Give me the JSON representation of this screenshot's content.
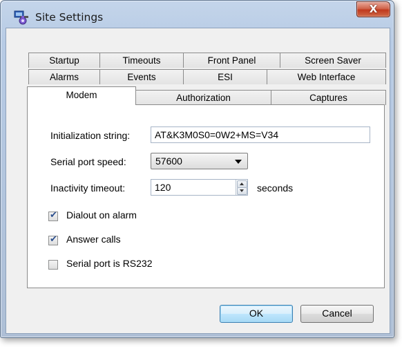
{
  "window": {
    "title": "Site Settings",
    "close_label": "X",
    "icon": "site-settings-app-icon"
  },
  "tabs": {
    "row1": [
      "Startup",
      "Timeouts",
      "Front Panel",
      "Screen Saver"
    ],
    "row2": [
      "Alarms",
      "Events",
      "ESI",
      "Web Interface"
    ],
    "row3": [
      "Modem",
      "Authorization",
      "Captures"
    ],
    "active": "Modem"
  },
  "modem": {
    "init_label": "Initialization string:",
    "init_value": "AT&K3M0S0=0W2+MS=V34",
    "speed_label": "Serial port speed:",
    "speed_value": "57600",
    "timeout_label": "Inactivity timeout:",
    "timeout_value": "120",
    "timeout_unit": "seconds",
    "dialout_label": "Dialout on alarm",
    "dialout_checked": true,
    "answer_label": "Answer calls",
    "answer_checked": true,
    "rs232_label": "Serial port is RS232",
    "rs232_checked": false
  },
  "buttons": {
    "ok": "OK",
    "cancel": "Cancel"
  },
  "colors": {
    "close_red": "#c0391d",
    "frame_blue": "#b7cbe5",
    "default_button_blue": "#3c7fb1",
    "check_blue": "#2b4f8e"
  }
}
